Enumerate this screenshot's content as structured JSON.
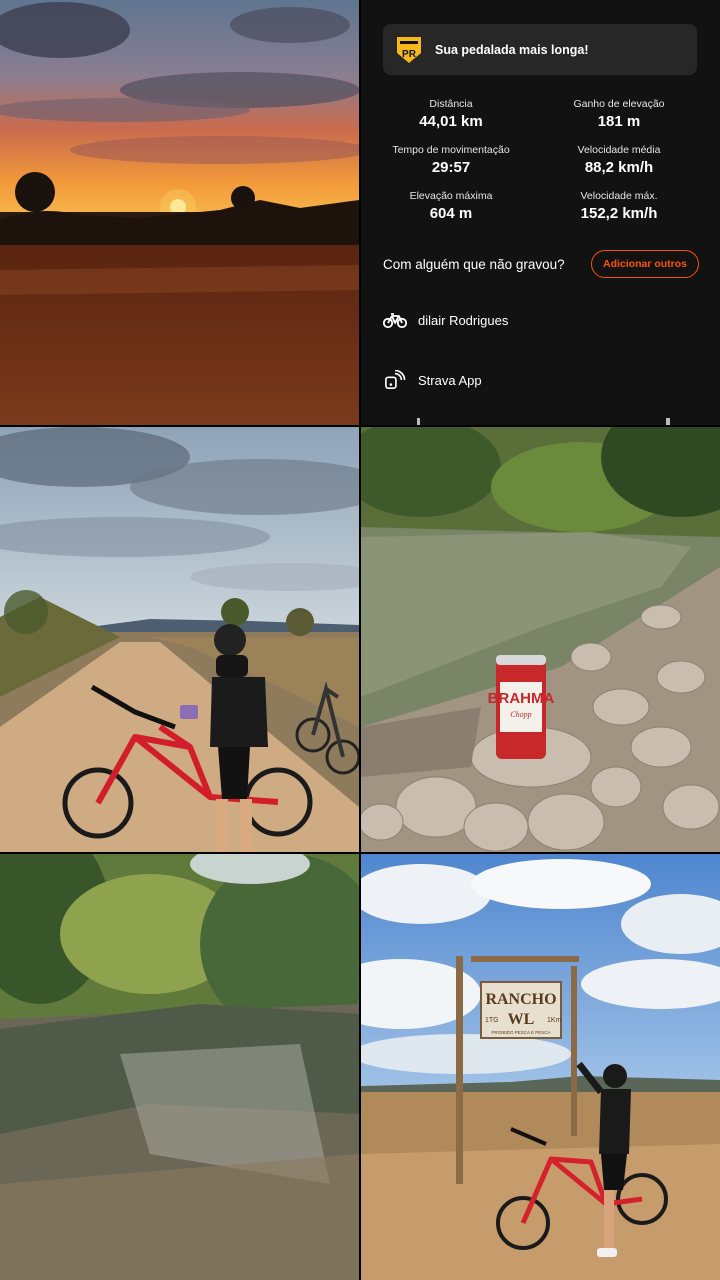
{
  "banner": {
    "badge_icon": "personal-record-badge-icon",
    "badge_text": "PR",
    "text": "Sua pedalada mais longa!"
  },
  "stats": [
    {
      "label": "Distância",
      "value": "44,01 km"
    },
    {
      "label": "Ganho de elevação",
      "value": "181 m"
    },
    {
      "label": "Tempo de movimentação",
      "value": "29:57"
    },
    {
      "label": "Velocidade média",
      "value": "88,2 km/h"
    },
    {
      "label": "Elevação máxima",
      "value": "604 m"
    },
    {
      "label": "Velocidade máx.",
      "value": "152,2 km/h"
    }
  ],
  "prompt": {
    "text": "Com alguém que não gravou?",
    "button": "Adicionar outros"
  },
  "devices": [
    {
      "icon": "bike-icon",
      "label": "dilair Rodrigues"
    },
    {
      "icon": "strava-app-icon",
      "label": "Strava App"
    }
  ],
  "photos": {
    "p4": {
      "can_text": "BRAHMA",
      "can_sub": "Chopp"
    },
    "p6": {
      "sign_line1": "RANCHO",
      "sign_line2": "WL",
      "sign_left": "1TG",
      "sign_right": "1Km",
      "sign_bottom": "PROIBIDO PESCA E PESCA"
    }
  },
  "colors": {
    "accent": "#fc5200",
    "panel_bg": "#121212",
    "banner_bg": "#272727",
    "badge": "#f6b81a"
  }
}
